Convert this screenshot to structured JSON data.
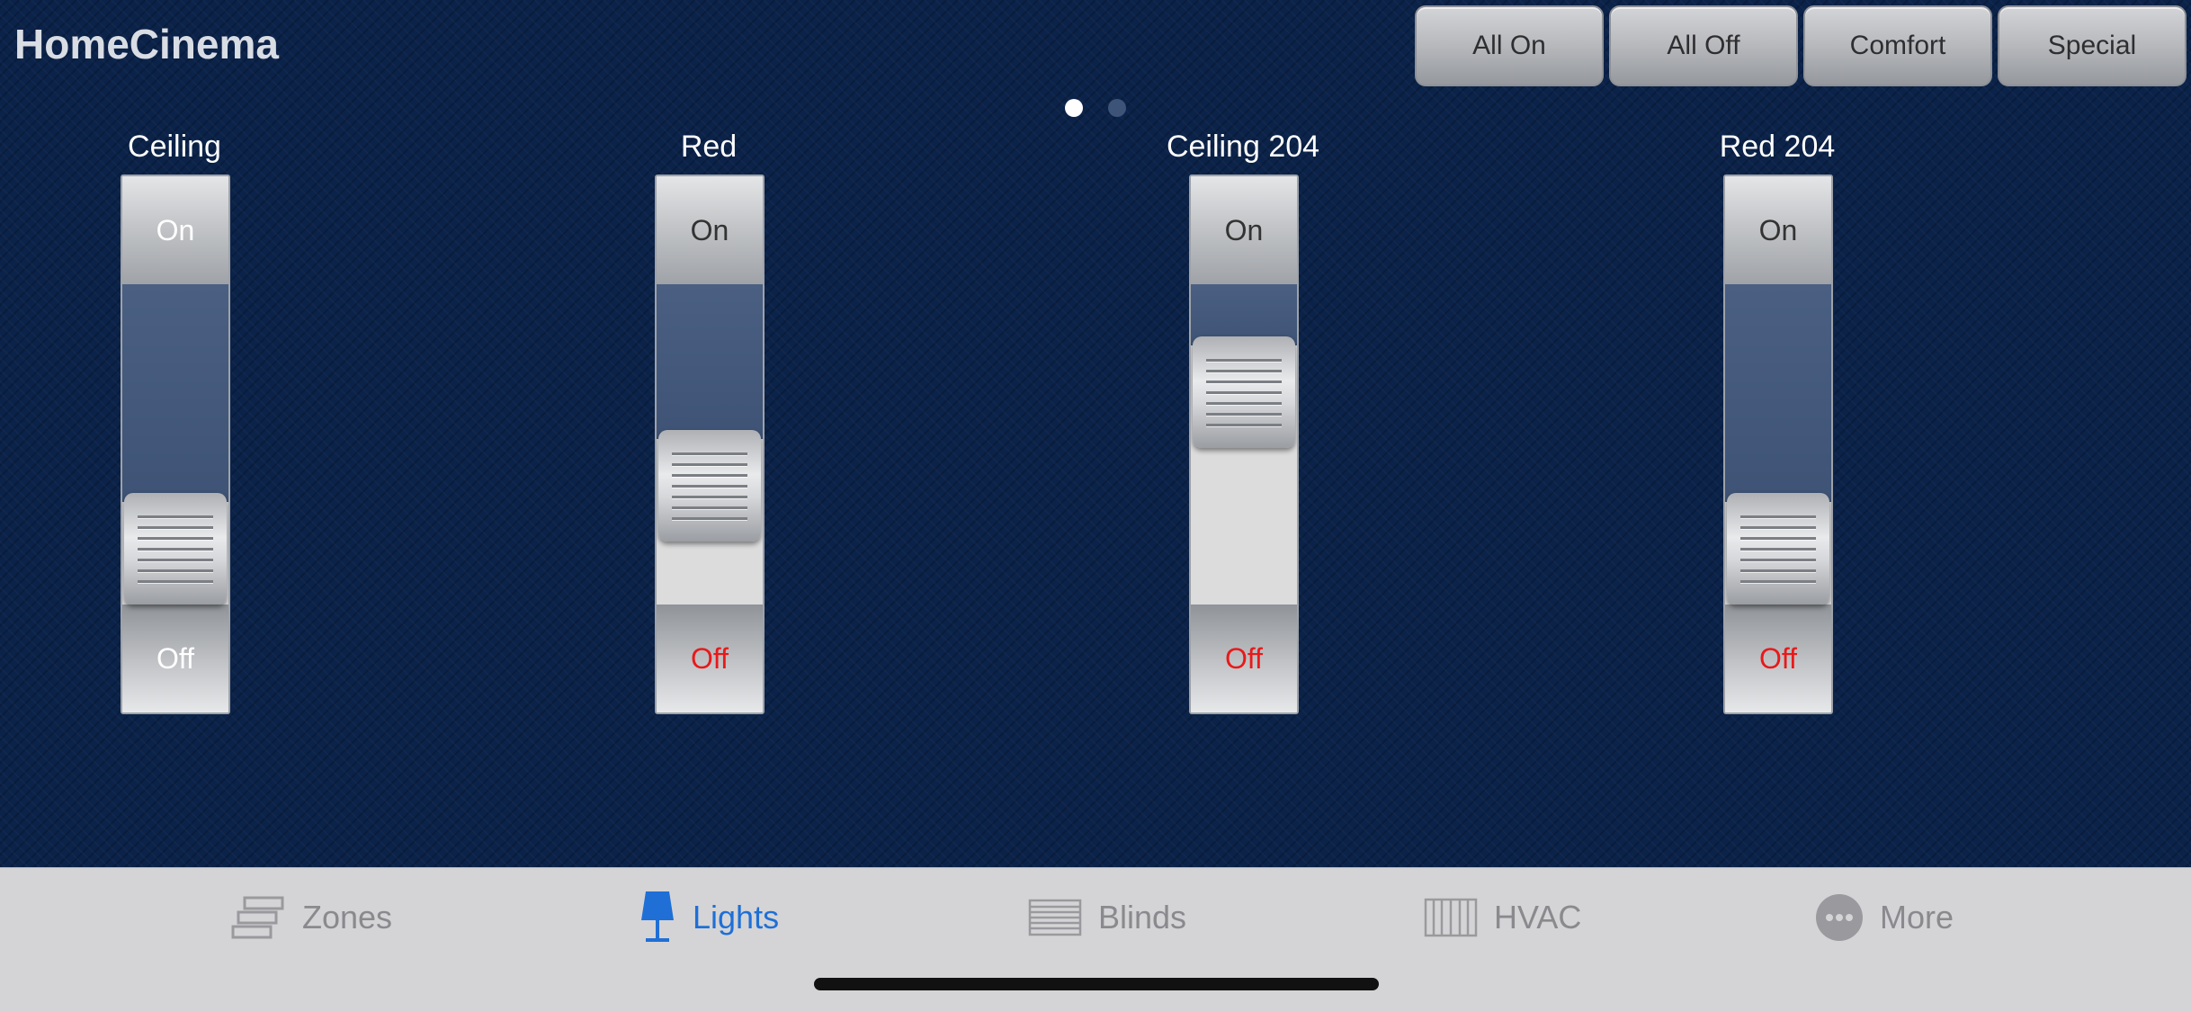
{
  "app": {
    "title": "HomeCinema"
  },
  "scenes": [
    {
      "label": "All On"
    },
    {
      "label": "All Off"
    },
    {
      "label": "Comfort"
    },
    {
      "label": "Special"
    }
  ],
  "pager": {
    "pages": 2,
    "current": 1
  },
  "sliders": [
    {
      "label": "Ceiling",
      "on_label": "On",
      "off_label": "Off",
      "off_color": "#ffffff",
      "on_color": "#ffffff",
      "level": 0.0
    },
    {
      "label": "Red",
      "on_label": "On",
      "off_label": "Off",
      "off_color": "#e8191a",
      "on_color": "#333333",
      "level": 0.3
    },
    {
      "label": "Ceiling 204",
      "on_label": "On",
      "off_label": "Off",
      "off_color": "#e8191a",
      "on_color": "#333333",
      "level": 0.75
    },
    {
      "label": "Red 204",
      "on_label": "On",
      "off_label": "Off",
      "off_color": "#e8191a",
      "on_color": "#333333",
      "level": 0.0
    }
  ],
  "tabs": [
    {
      "label": "Zones",
      "icon": "zones-icon",
      "active": false
    },
    {
      "label": "Lights",
      "icon": "lamp-icon",
      "active": true
    },
    {
      "label": "Blinds",
      "icon": "blinds-icon",
      "active": false
    },
    {
      "label": "HVAC",
      "icon": "radiator-icon",
      "active": false
    },
    {
      "label": "More",
      "icon": "more-icon",
      "active": false
    }
  ],
  "colors": {
    "background": "#0b2249",
    "accent": "#1f6fd6",
    "tab_inactive": "#8a8a8e",
    "off_red": "#e8191a"
  }
}
